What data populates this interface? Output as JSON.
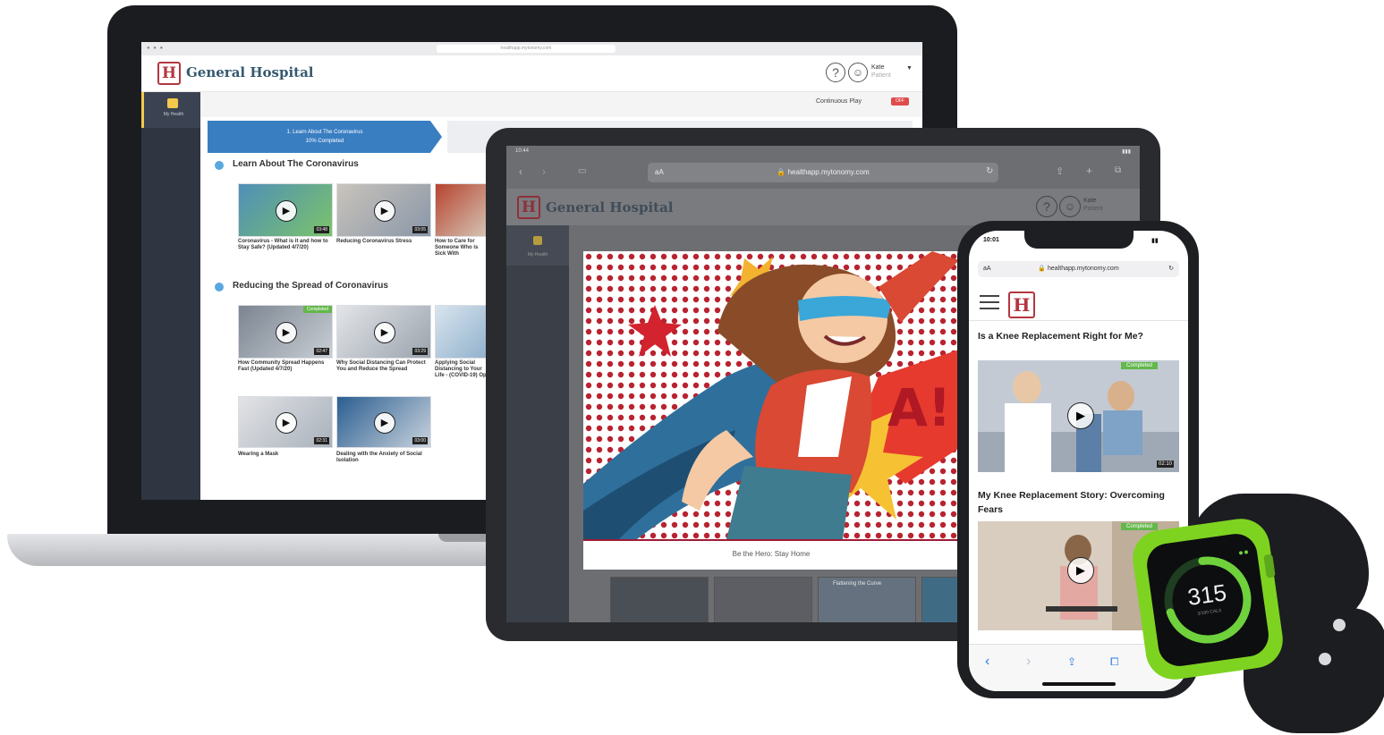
{
  "laptop": {
    "browser_url": "healthapp.mytonomy.com",
    "app_title": "General Hospital",
    "logo_letter": "H",
    "help_symbol": "?",
    "user_name": "Kate",
    "user_role": "Patient",
    "sidebar_label": "My Health",
    "continuous_play_label": "Continuous Play",
    "toggle_label": "OFF",
    "progress_step": {
      "line1": "1. Learn About The Coronavirus",
      "line2": "10% Completed"
    },
    "sections": [
      {
        "title": "Learn About The Coronavirus",
        "videos": [
          {
            "caption": "Coronavirus - What is it and how to Stay Safe? (Updated 4/7/20)",
            "duration": "03:48"
          },
          {
            "caption": "Reducing Coronavirus Stress",
            "duration": "03:05"
          },
          {
            "caption": "How to Care for Someone Who is Sick With",
            "duration": ""
          }
        ]
      },
      {
        "title": "Reducing the Spread of Coronavirus",
        "videos": [
          {
            "caption": "How Community Spread Happens Fast (Updated 4/7/20)",
            "duration": "02:47",
            "badge": "Completed"
          },
          {
            "caption": "Why Social Distancing Can Protect You and Reduce the Spread",
            "duration": "03:29"
          },
          {
            "caption": "Applying Social Distancing to Your Life - (COVID-19) Op",
            "duration": ""
          },
          {
            "caption": "Wearing a Mask",
            "duration": "02:31"
          },
          {
            "caption": "Dealing with the Anxiety of Social Isolation",
            "duration": "03:00"
          }
        ]
      }
    ]
  },
  "tablet": {
    "status_time": "10:44",
    "aa_label": "aA",
    "url": "healthapp.mytonomy.com",
    "app_title": "General Hospital",
    "logo_letter": "H",
    "help_symbol": "?",
    "user_name": "Kate",
    "user_role": "Patient",
    "sidebar_label": "My Health",
    "hero_caption": "Be the Hero: Stay Home",
    "thumb_label": "Flattening the Curve"
  },
  "phone": {
    "status_time": "10:01",
    "aa_label": "aA",
    "url": "healthapp.mytonomy.com",
    "logo_letter": "H",
    "article1_title": "Is a Knee Replacement Right for Me?",
    "article1_badge": "Completed",
    "article1_duration": "02:10",
    "article2_title": "My Knee Replacement Story: Overcoming Fears",
    "article2_badge": "Completed"
  },
  "watch": {
    "value": "315",
    "sub_label": "3/180 CALS",
    "ring_progress": 0.72
  },
  "colors": {
    "brand_red": "#b4363f",
    "title_blue": "#35596f",
    "progress_blue": "#3a7ec2",
    "sidebar_dark": "#2f3541",
    "watch_green": "#7ed321"
  }
}
